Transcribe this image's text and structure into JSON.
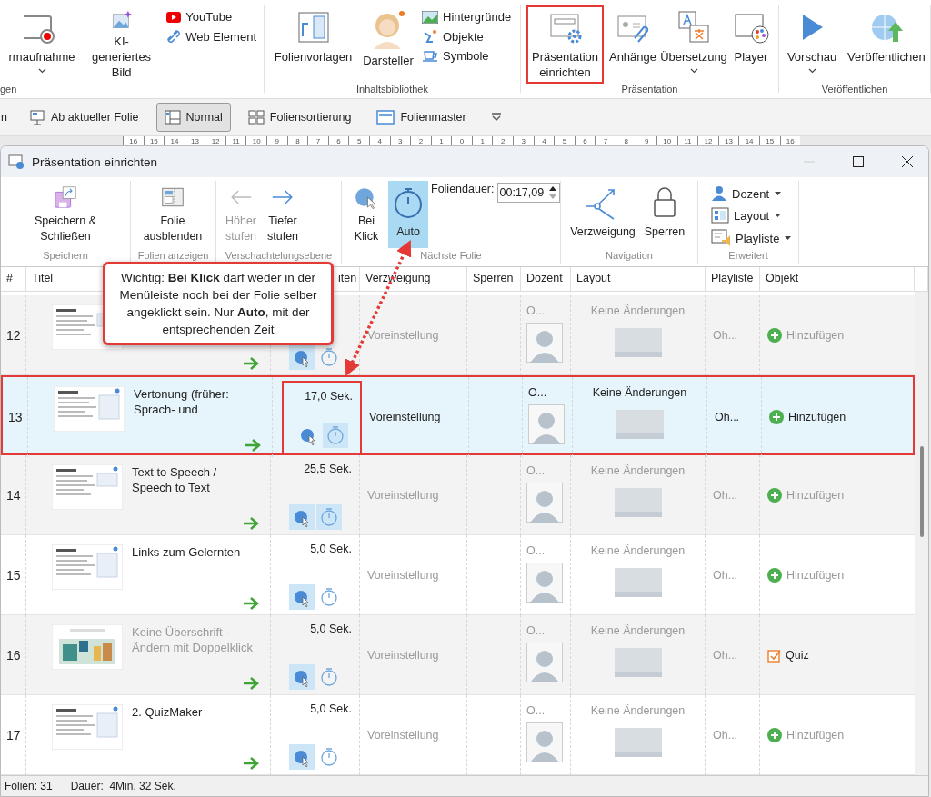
{
  "ribbon": {
    "groups": [
      {
        "label": "gen",
        "items": [
          {
            "kind": "large",
            "label": "rmaufnahme",
            "dropdown": true
          },
          {
            "kind": "large",
            "label": "KI-generiertes Bild"
          },
          {
            "kind": "stack",
            "items": [
              {
                "label": "YouTube"
              },
              {
                "label": "Web Element"
              }
            ]
          }
        ]
      },
      {
        "label": "Inhaltsbibliothek",
        "items": [
          {
            "kind": "large",
            "label": "Folienvorlagen"
          },
          {
            "kind": "large",
            "label": "Darsteller"
          },
          {
            "kind": "stack",
            "items": [
              {
                "label": "Hintergründe"
              },
              {
                "label": "Objekte"
              },
              {
                "label": "Symbole"
              }
            ]
          }
        ]
      },
      {
        "label": "Präsentation",
        "items": [
          {
            "kind": "large",
            "label": "Präsentation einrichten",
            "annotated": true
          },
          {
            "kind": "large",
            "label": "Anhänge"
          },
          {
            "kind": "large",
            "label": "Übersetzung",
            "dropdown": true
          },
          {
            "kind": "large",
            "label": "Player"
          }
        ]
      },
      {
        "label": "Veröffentlichen",
        "items": [
          {
            "kind": "large",
            "label": "Vorschau",
            "dropdown": true
          },
          {
            "kind": "large",
            "label": "Veröffentlichen"
          }
        ]
      }
    ]
  },
  "view_bar": {
    "items": [
      {
        "label": "n",
        "selected": false
      },
      {
        "label": "Ab aktueller Folie",
        "selected": false
      },
      {
        "label": "Normal",
        "selected": true
      },
      {
        "label": "Foliensortierung",
        "selected": false
      },
      {
        "label": "Folienmaster",
        "selected": false
      }
    ]
  },
  "ruler": {
    "labels": [
      "16",
      "15",
      "14",
      "13",
      "12",
      "11",
      "10",
      "9",
      "8",
      "7",
      "6",
      "5",
      "4",
      "3",
      "2",
      "1",
      "0",
      "1",
      "2",
      "3",
      "4",
      "5",
      "6",
      "7",
      "8",
      "9",
      "10",
      "11",
      "12",
      "13",
      "14",
      "15",
      "16"
    ]
  },
  "dialog": {
    "title": "Präsentation einrichten",
    "ribbon": {
      "groups": [
        {
          "label": "Speichern",
          "items": [
            {
              "kind": "large",
              "label": "Speichern & Schließen",
              "disabled": false,
              "selected": false
            }
          ]
        },
        {
          "label": "Folien anzeigen",
          "items": [
            {
              "kind": "large",
              "label": "Folie ausblenden",
              "disabled": false,
              "selected": false
            }
          ]
        },
        {
          "label": "Verschachtelungsebene",
          "items": [
            {
              "kind": "large",
              "label": "Höher stufen",
              "disabled": true,
              "selected": false
            },
            {
              "kind": "large",
              "label": "Tiefer stufen",
              "disabled": false,
              "selected": false
            }
          ]
        },
        {
          "label": "Nächste Folie",
          "items": [
            {
              "kind": "large",
              "label": "Bei Klick",
              "disabled": false,
              "selected": false
            },
            {
              "kind": "large",
              "label": "Auto",
              "disabled": false,
              "selected": true
            },
            {
              "kind": "field",
              "label": "Foliendauer:",
              "value": "00:17,09"
            }
          ]
        },
        {
          "label": "Navigation",
          "items": [
            {
              "kind": "large",
              "label": "Verzweigung",
              "disabled": false,
              "selected": false
            },
            {
              "kind": "large",
              "label": "Sperren",
              "disabled": false,
              "selected": false
            }
          ]
        },
        {
          "label": "Erweitert",
          "items": [
            {
              "kind": "stack",
              "items": [
                {
                  "label": "Dozent",
                  "dropdown": true
                },
                {
                  "label": "Layout",
                  "dropdown": true
                },
                {
                  "label": "Playliste",
                  "dropdown": true
                }
              ]
            }
          ]
        }
      ]
    },
    "table": {
      "columns": [
        "#",
        "Titel",
        "iten",
        "Verzweigung",
        "Sperren",
        "Dozent",
        "Layout",
        "Playliste",
        "Objekt"
      ],
      "rows": [
        {
          "number": "12",
          "selected": false,
          "annotated": false,
          "click": true,
          "auto": false,
          "time_annotated": false,
          "branch": "Voreinstellung",
          "lecturer": "O...",
          "layout": "Keine Änderungen",
          "playlist": "Oh...",
          "object": {
            "kind": "add",
            "label": "Hinzufügen"
          }
        },
        {
          "number": "13",
          "selected": true,
          "annotated": true,
          "title": "Vertonung (früher: Sprach- und",
          "title_placeholder": false,
          "time": "17,0 Sek.",
          "click": false,
          "auto": true,
          "time_annotated": true,
          "branch": "Voreinstellung",
          "lecturer": "O...",
          "layout": "Keine Änderungen",
          "playlist": "Oh...",
          "object": {
            "kind": "add",
            "label": "Hinzufügen"
          }
        },
        {
          "number": "14",
          "selected": false,
          "annotated": false,
          "title": "Text to Speech / Speech to Text",
          "title_placeholder": false,
          "time": "25,5 Sek.",
          "click": true,
          "auto": true,
          "time_annotated": false,
          "branch": "Voreinstellung",
          "lecturer": "O...",
          "layout": "Keine Änderungen",
          "playlist": "Oh...",
          "object": {
            "kind": "add",
            "label": "Hinzufügen"
          }
        },
        {
          "number": "15",
          "selected": false,
          "annotated": false,
          "title": "Links zum Gelernten",
          "title_placeholder": false,
          "time": "5,0 Sek.",
          "click": true,
          "auto": false,
          "time_annotated": false,
          "branch": "Voreinstellung",
          "lecturer": "O...",
          "layout": "Keine Änderungen",
          "playlist": "Oh...",
          "object": {
            "kind": "add",
            "label": "Hinzufügen"
          }
        },
        {
          "number": "16",
          "selected": false,
          "annotated": false,
          "title": "Keine Überschrift - Ändern mit Doppelklick",
          "title_placeholder": true,
          "time": "5,0 Sek.",
          "click": true,
          "auto": false,
          "time_annotated": false,
          "branch": "Voreinstellung",
          "lecturer": "O...",
          "layout": "Keine Änderungen",
          "playlist": "Oh...",
          "object": {
            "kind": "quiz",
            "label": "Quiz"
          }
        },
        {
          "number": "17",
          "selected": false,
          "annotated": false,
          "title": "2. QuizMaker",
          "title_placeholder": false,
          "time": "5,0 Sek.",
          "click": true,
          "auto": false,
          "time_annotated": false,
          "branch": "Voreinstellung",
          "lecturer": "O...",
          "layout": "Keine Änderungen",
          "playlist": "Oh...",
          "object": {
            "kind": "add",
            "label": "Hinzufügen"
          }
        }
      ]
    },
    "status_bar": [
      "Folien: 31",
      "Dauer:  4Min. 32 Sek."
    ]
  },
  "callout": {
    "text": "Wichtig: **Bei Klick** darf weder in der Menüleiste noch bei der Folie selber angeklickt sein. Nur **Auto**, mit der entsprechenden Zeit"
  }
}
